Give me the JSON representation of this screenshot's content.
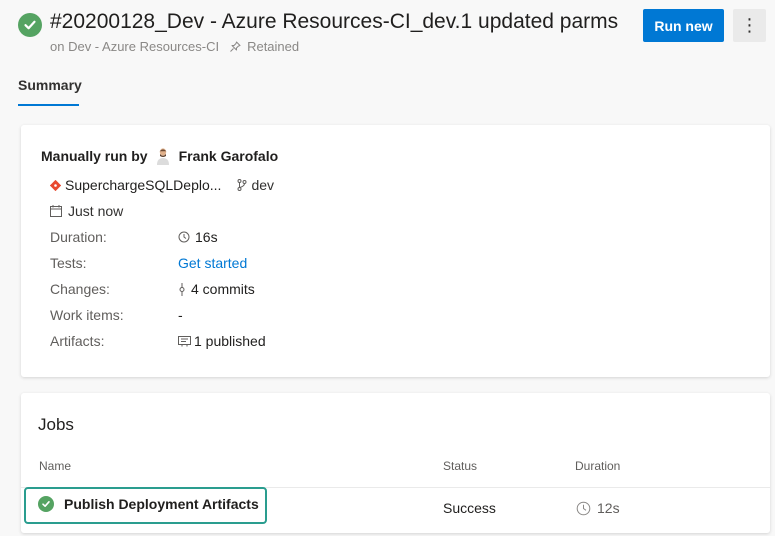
{
  "header": {
    "title": "#20200128_Dev - Azure Resources-CI_dev.1 updated parms",
    "subtitle_branch": "on Dev - Azure Resources-CI",
    "retained": "Retained",
    "run_new_label": "Run new",
    "more_label": "⋮",
    "status_color": "#55a362"
  },
  "tabs": [
    {
      "label": "Summary",
      "active": true
    }
  ],
  "summary": {
    "manually_run_by": "Manually run by",
    "user_name": "Frank Garofalo",
    "repo": "SuperchargeSQLDeplo...",
    "branch": "dev",
    "time": "Just now",
    "rows": [
      {
        "label": "Duration:",
        "value": "16s",
        "icon": "clock-icon"
      },
      {
        "label": "Tests:",
        "value": "Get started",
        "icon": ""
      },
      {
        "label": "Changes:",
        "value": "4 commits",
        "icon": "commit-icon"
      },
      {
        "label": "Work items:",
        "value": "-",
        "icon": ""
      },
      {
        "label": "Artifacts:",
        "value": "1 published",
        "icon": "artifact-icon"
      }
    ]
  },
  "jobs": {
    "title": "Jobs",
    "columns": [
      "Name",
      "Status",
      "Duration"
    ],
    "rows": [
      {
        "name": "Publish Deployment Artifacts",
        "status": "Success",
        "duration": "12s"
      }
    ]
  },
  "colors": {
    "accent": "#0078d4",
    "success": "#55a362",
    "highlight": "#2a9d8f"
  }
}
